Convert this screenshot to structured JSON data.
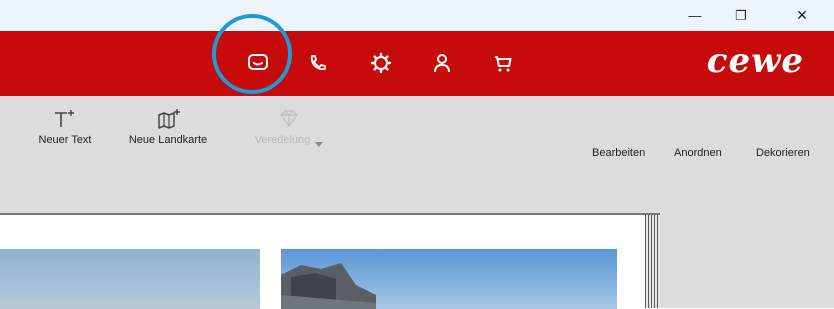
{
  "window": {
    "controls": [
      {
        "name": "minimize-button",
        "glyph": "—"
      },
      {
        "name": "restore-button",
        "glyph": "❐"
      },
      {
        "name": "close-button",
        "glyph": "✕"
      }
    ]
  },
  "header": {
    "logo": "cewe",
    "icons": [
      "chat-icon",
      "phone-icon",
      "settings-icon",
      "user-icon",
      "cart-icon"
    ],
    "highlight_color": "#1e9bd7",
    "brand_color": "#c70a0a"
  },
  "ribbon": {
    "tools": [
      {
        "label": "Neuer Text",
        "icon": "text-add-icon",
        "enabled": true
      },
      {
        "label": "Neue Landkarte",
        "icon": "map-add-icon",
        "enabled": true
      },
      {
        "label": "Veredelung",
        "icon": "diamond-icon",
        "enabled": false
      }
    ],
    "menus": [
      "Bearbeiten",
      "Anordnen",
      "Dekorieren"
    ]
  }
}
